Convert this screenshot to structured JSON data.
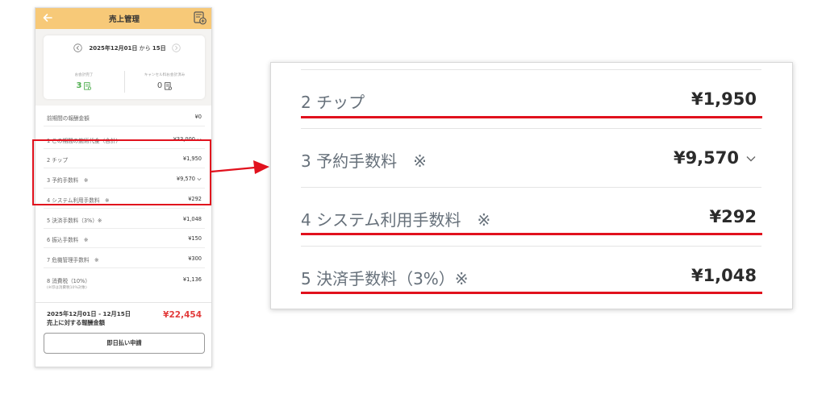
{
  "phone": {
    "header_title": "売上管理",
    "period": {
      "bold": "2025年12月01日",
      "from": " から ",
      "to": "15日"
    },
    "paid": {
      "label": "お会計完了",
      "value": "3"
    },
    "cancelled": {
      "label": "キャンセル料お会計済み",
      "value": "0"
    },
    "rows": [
      {
        "label": "前期間の報酬金額",
        "amount": "¥0"
      },
      {
        "label": "1 この期間の施術代金（合計）",
        "amount": "¥33,000"
      },
      {
        "label": "2 チップ",
        "amount": "¥1,950"
      },
      {
        "label": "3 予約手数料　※",
        "amount": "¥9,570"
      },
      {
        "label": "4 システム利用手数料　※",
        "amount": "¥292"
      },
      {
        "label": "5 決済手数料（3%）※",
        "amount": "¥1,048"
      },
      {
        "label": "6 振込手数料　※",
        "amount": "¥150"
      },
      {
        "label": "7 危機管理手数料　※",
        "amount": "¥300"
      },
      {
        "label": "8 消費税（10%）",
        "amount": "¥1,136",
        "sub": "(※印は消費税10%対象)"
      }
    ],
    "total_label_line1": "2025年12月01日 - 12月15日",
    "total_label_line2": "売上に対する報酬金額",
    "total_amount": "¥22,454",
    "apply_button": "即日払い申請"
  },
  "zoom": {
    "rows": [
      {
        "label": "2  チップ",
        "amount": "¥1,950"
      },
      {
        "label": "3  予約手数料　※",
        "amount": "¥9,570"
      },
      {
        "label": "4  システム利用手数料　※",
        "amount": "¥292"
      },
      {
        "label": "5  決済手数料（3%）※",
        "amount": "¥1,048"
      }
    ]
  },
  "colors": {
    "header_bg": "#f7c978",
    "highlight": "#e1111d",
    "positive_count": "#4fae4f",
    "total_amount": "#e23b3b"
  },
  "icons": [
    "back-arrow-icon",
    "calculator-icon",
    "chevron-left-icon",
    "chevron-right-icon",
    "document-icon",
    "chevron-down-icon"
  ]
}
